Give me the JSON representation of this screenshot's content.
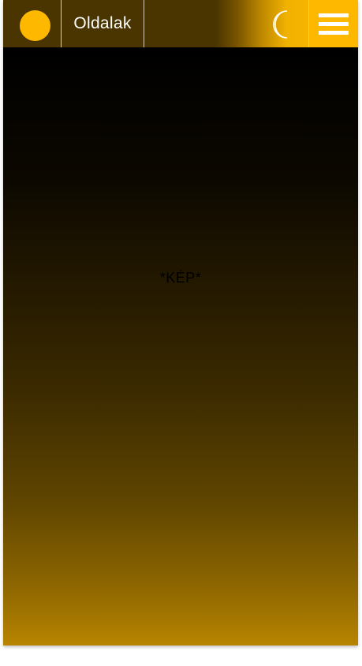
{
  "header": {
    "logo_icon": "circle-logo-icon",
    "nav_label": "Oldalak",
    "theme_icon": "crescent-moon-icon",
    "menu_icon": "hamburger-menu-icon"
  },
  "hero": {
    "placeholder_text": "*KÉP*"
  },
  "colors": {
    "accent": "#ffb800",
    "header_dark": "#4a3500",
    "hero_top": "#000000",
    "hero_bottom": "#b88400",
    "text_light": "#ffffff"
  }
}
